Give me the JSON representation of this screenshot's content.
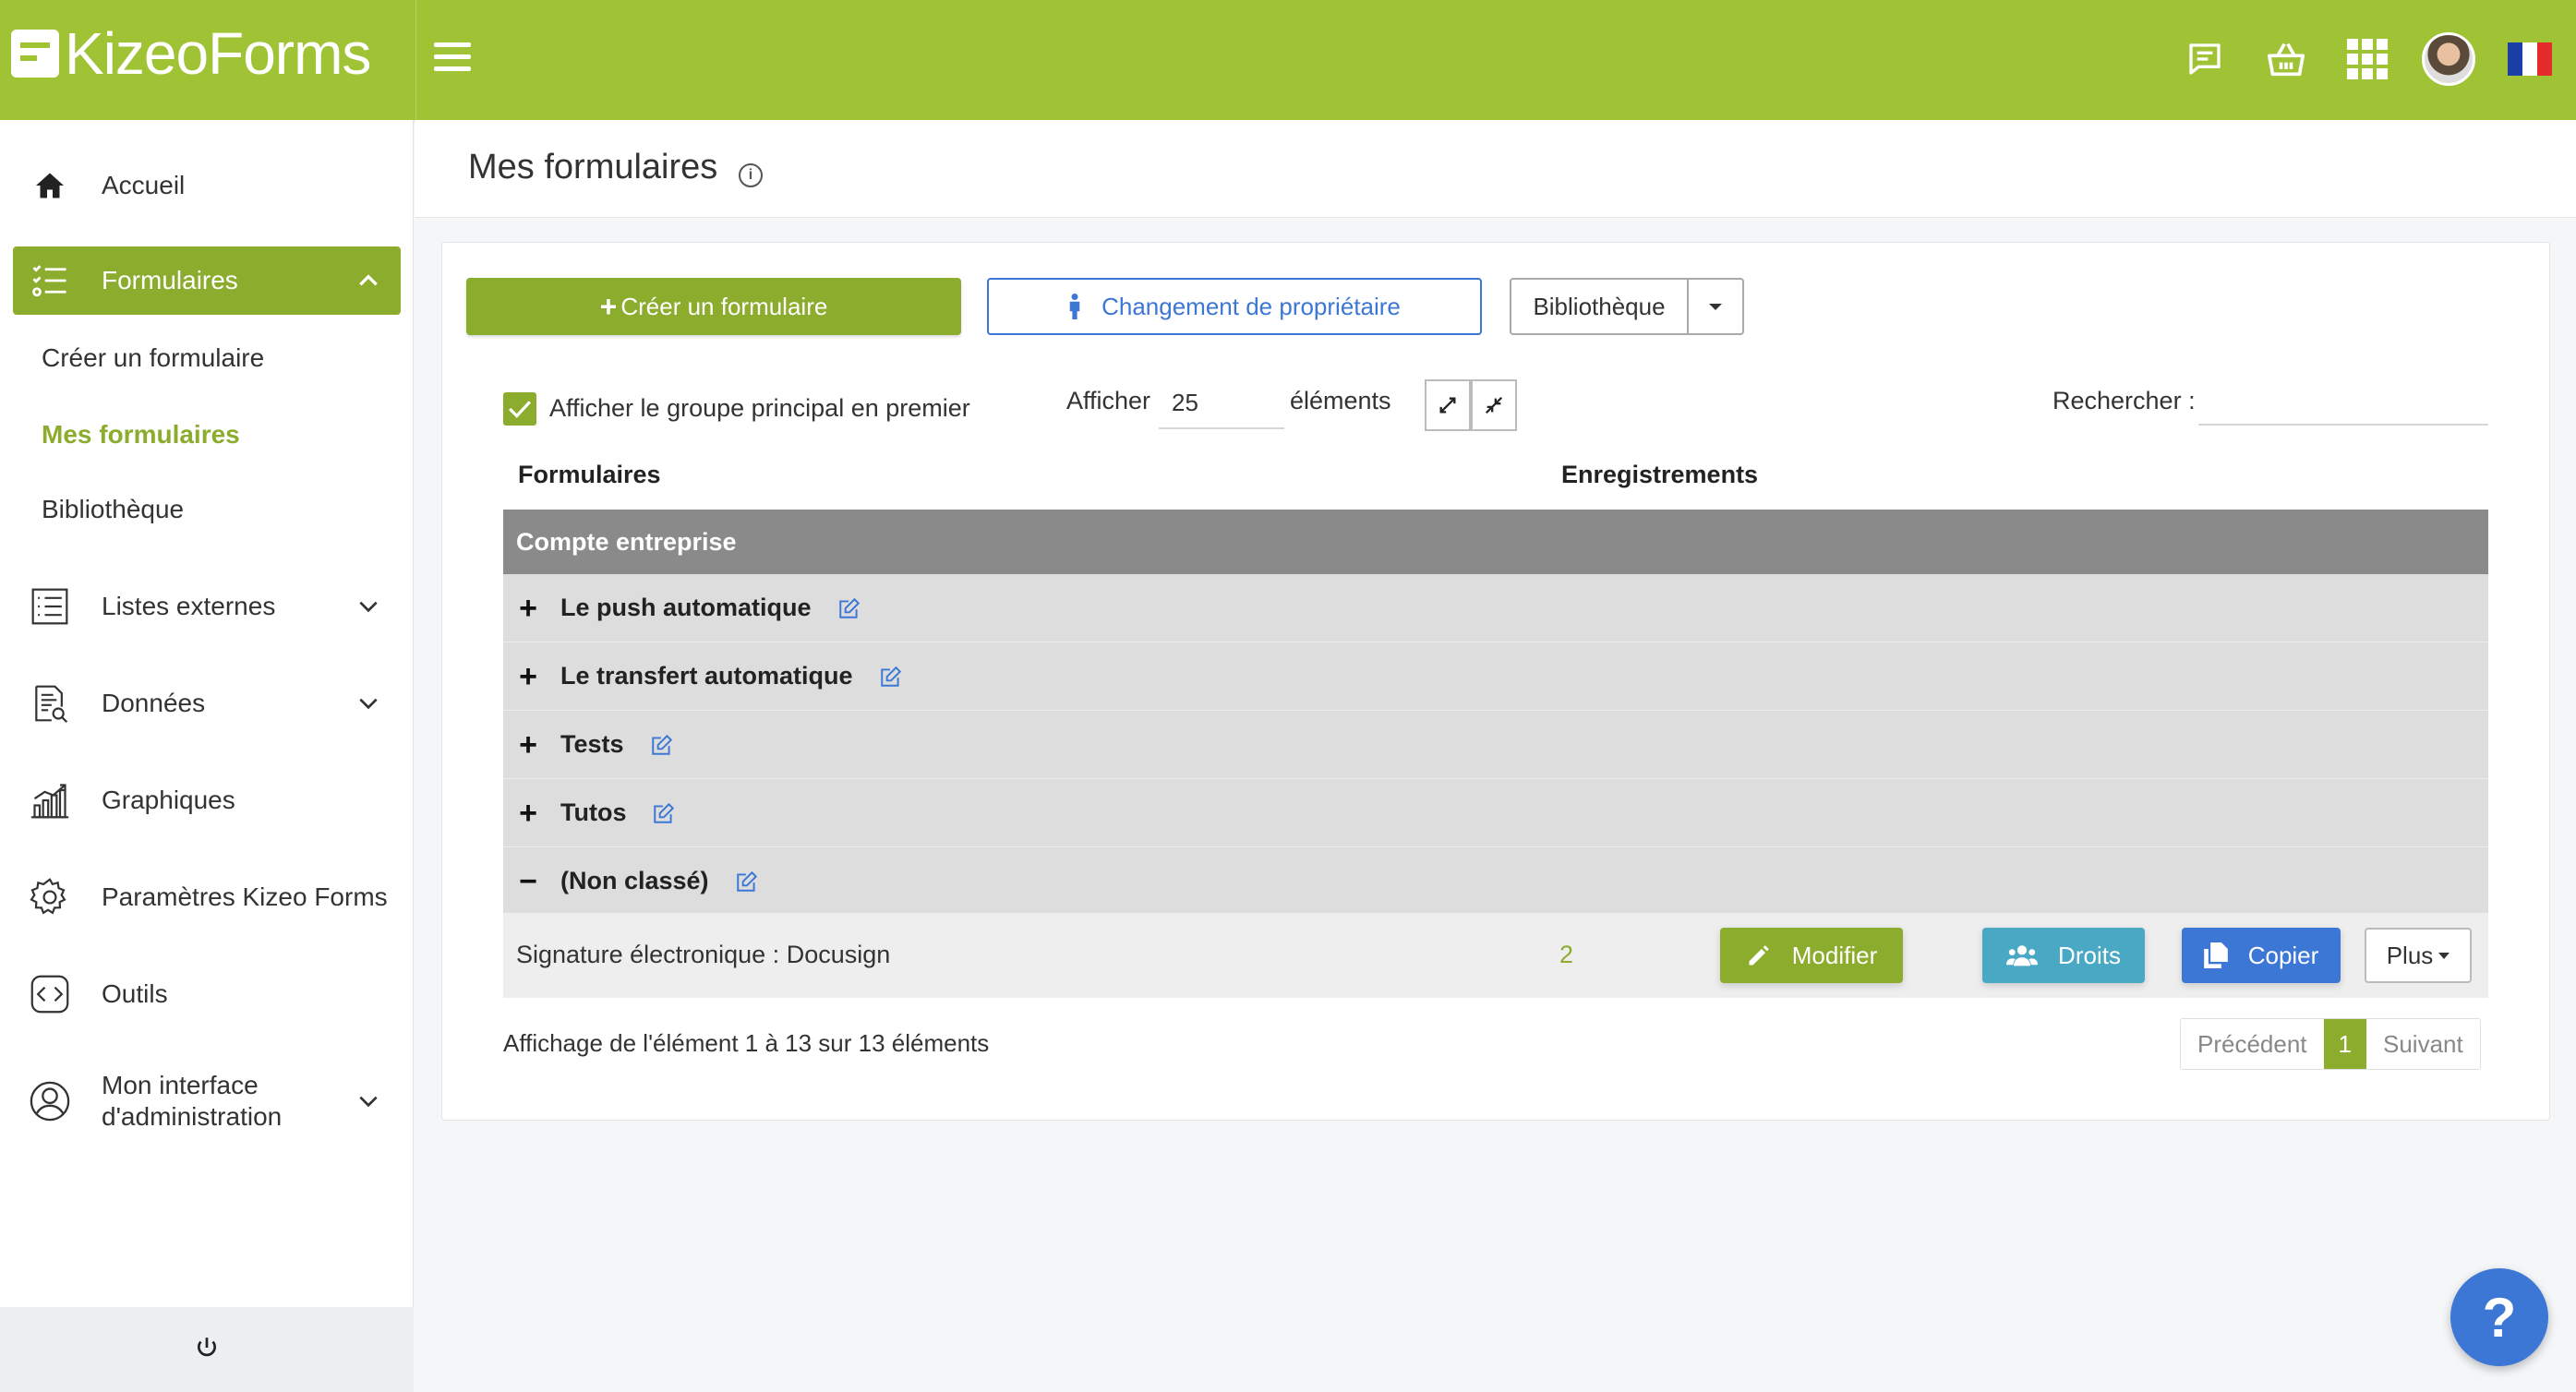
{
  "app": {
    "logo_text": "KizeoForms"
  },
  "topbar": {
    "icons": [
      "chat-icon",
      "basket-icon",
      "apps-grid-icon",
      "avatar",
      "france-flag-icon"
    ],
    "accent": "#a0c235"
  },
  "sidebar": {
    "items": [
      {
        "label": "Accueil",
        "icon": "home-icon"
      },
      {
        "label": "Formulaires",
        "icon": "forms-list-icon",
        "active": true
      },
      {
        "label": "Listes externes",
        "icon": "list-icon"
      },
      {
        "label": "Données",
        "icon": "data-search-icon"
      },
      {
        "label": "Graphiques",
        "icon": "chart-icon"
      },
      {
        "label": "Paramètres Kizeo Forms",
        "icon": "gear-icon"
      },
      {
        "label": "Outils",
        "icon": "code-icon"
      },
      {
        "label": "Mon interface",
        "label2": "d'administration",
        "icon": "user-circle-icon"
      }
    ],
    "subitems": [
      {
        "label": "Créer un formulaire"
      },
      {
        "label": "Mes formulaires",
        "current": true
      },
      {
        "label": "Bibliothèque"
      }
    ],
    "footer_icon": "power-icon"
  },
  "page": {
    "title": "Mes formulaires"
  },
  "toolbar": {
    "create_label": "Créer un formulaire",
    "owner_label": "Changement de propriétaire",
    "library_label": "Bibliothèque"
  },
  "options": {
    "main_group_first_label": "Afficher le groupe principal en premier",
    "show_label": "Afficher",
    "page_size": "25",
    "elements_label": "éléments",
    "search_label": "Rechercher :"
  },
  "table": {
    "headers": [
      "Formulaires",
      "Enregistrements"
    ],
    "group_header": "Compte entreprise",
    "groups": [
      {
        "name": "Le push automatique",
        "toggle": "+"
      },
      {
        "name": "Le transfert automatique",
        "toggle": "+"
      },
      {
        "name": "Tests",
        "toggle": "+"
      },
      {
        "name": "Tutos",
        "toggle": "+"
      },
      {
        "name": "(Non classé)",
        "toggle": "−"
      }
    ],
    "rows": [
      {
        "name": "Signature électronique : Docusign",
        "records": "2"
      }
    ],
    "actions": {
      "modify": "Modifier",
      "rights": "Droits",
      "copy": "Copier",
      "more": "Plus"
    }
  },
  "footer": {
    "info": "Affichage de l'élément 1 à 13 sur 13 éléments",
    "prev": "Précédent",
    "page": "1",
    "next": "Suivant"
  },
  "help": {
    "label": "?"
  }
}
